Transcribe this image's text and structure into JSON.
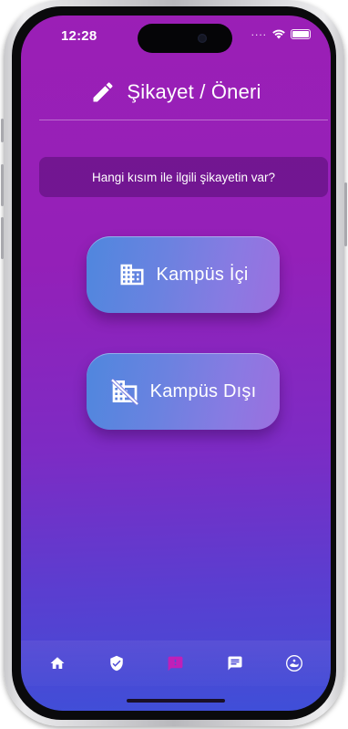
{
  "status_bar": {
    "time": "12:28",
    "signal_dots": "....",
    "wifi_icon": "wifi-icon",
    "battery_icon": "battery-icon"
  },
  "header": {
    "icon": "pencil-icon",
    "title": "Şikayet / Öneri"
  },
  "question": {
    "text": "Hangi kısım ile ilgili şikayetin var?"
  },
  "choices": [
    {
      "label": "Kampüs İçi",
      "icon": "building-icon"
    },
    {
      "label": "Kampüs Dışı",
      "icon": "building-off-icon"
    }
  ],
  "tab_bar": {
    "items": [
      {
        "icon": "home-icon",
        "active": false
      },
      {
        "icon": "shield-check-icon",
        "active": false
      },
      {
        "icon": "report-icon",
        "active": true
      },
      {
        "icon": "message-icon",
        "active": false
      },
      {
        "icon": "profile-logo-icon",
        "active": false
      }
    ]
  },
  "colors": {
    "background_top": "#9b1fb6",
    "background_bottom": "#3f4fd8",
    "button_gradient_start": "#4f87de",
    "button_gradient_end": "#9b6fdf",
    "active_tab": "#c01fb8",
    "text": "#ffffff"
  }
}
